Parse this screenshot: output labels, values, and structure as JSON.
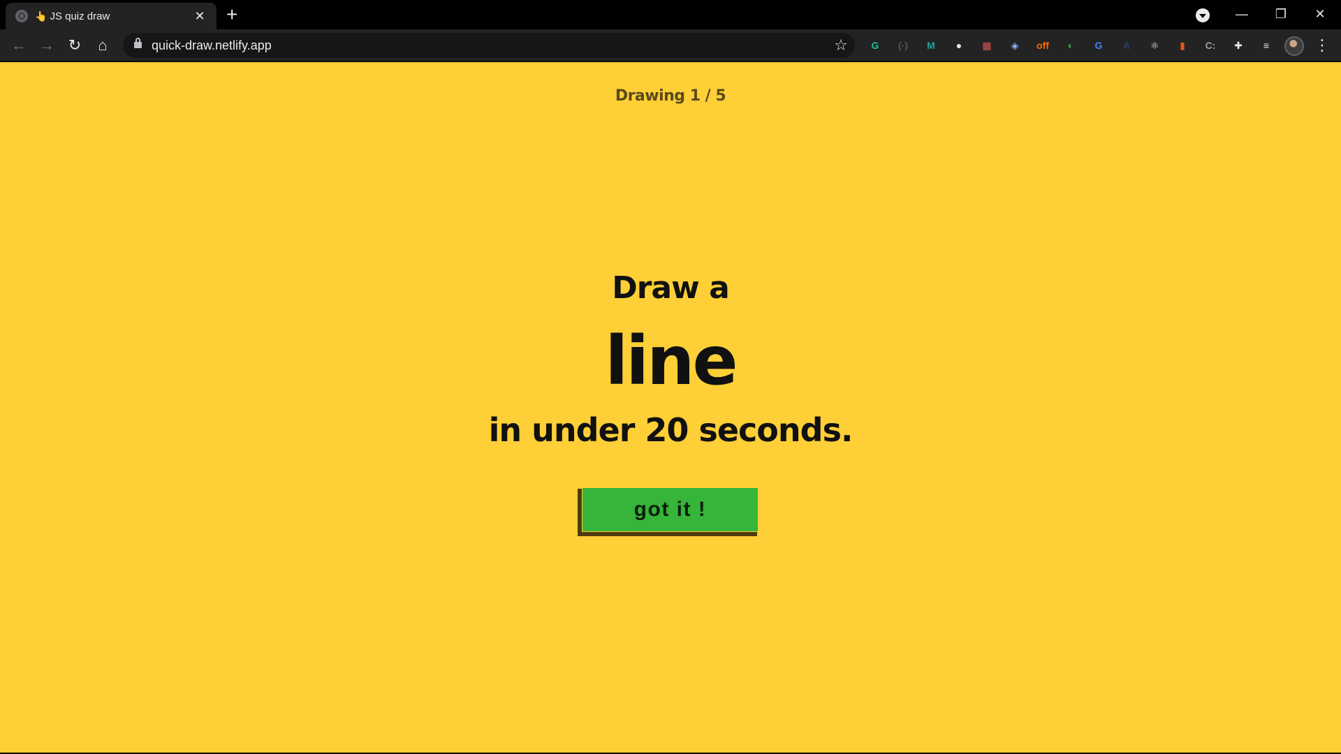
{
  "browser": {
    "tab": {
      "title": "JS quiz draw",
      "emoji": "👆",
      "close": "✕"
    },
    "new_tab": "+",
    "window_controls": {
      "minimize": "—",
      "maximize": "❐",
      "close": "✕"
    },
    "nav": {
      "back": "←",
      "forward": "→",
      "reload": "↻",
      "home": "⌂"
    },
    "url": "quick-draw.netlify.app",
    "star": "☆",
    "menu": "⋮",
    "extensions": [
      {
        "name": "grammarly-icon",
        "glyph": "G",
        "color": "#15c39a"
      },
      {
        "name": "code-ext-icon",
        "glyph": "(·)",
        "color": "#555555"
      },
      {
        "name": "m-ext-icon",
        "glyph": "M",
        "color": "#1aa3a3"
      },
      {
        "name": "github-icon",
        "glyph": "●",
        "color": "#e8eaed"
      },
      {
        "name": "grid-ext-icon",
        "glyph": "▦",
        "color": "#e25555"
      },
      {
        "name": "shield-ext-icon",
        "glyph": "◈",
        "color": "#8ab4f8"
      },
      {
        "name": "off-badge-ext-icon",
        "glyph": "off",
        "color": "#ff6d00"
      },
      {
        "name": "colorful-ext-icon",
        "glyph": "◐",
        "color": "#34a853"
      },
      {
        "name": "translate-icon",
        "glyph": "G",
        "color": "#4285f4"
      },
      {
        "name": "circle-ext-icon",
        "glyph": "A",
        "color": "#2b3b6b"
      },
      {
        "name": "react-icon",
        "glyph": "⚛",
        "color": "#e8eaed"
      },
      {
        "name": "bottle-ext-icon",
        "glyph": "▮",
        "color": "#e8541a"
      },
      {
        "name": "css-ext-icon",
        "glyph": "C:",
        "color": "#9aa0a6"
      },
      {
        "name": "puzzle-icon",
        "glyph": "✚",
        "color": "#e8eaed"
      },
      {
        "name": "playlist-icon",
        "glyph": "≡",
        "color": "#e8eaed"
      }
    ]
  },
  "page": {
    "progress": "Drawing 1 / 5",
    "prompt_prefix": "Draw a",
    "prompt_word": "line",
    "prompt_suffix": "in under 20 seconds.",
    "button_label": "got it !",
    "background_color": "#fecf36",
    "button_color": "#37b43a"
  }
}
